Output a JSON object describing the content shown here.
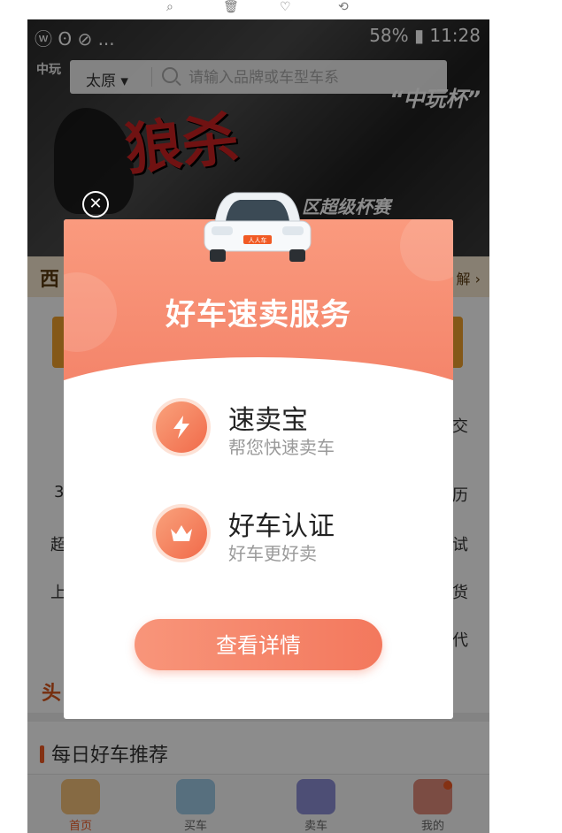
{
  "status_bar": {
    "left_icons_text": "ⓦ ʘ ⊘ ...",
    "right_text": "58% ▮ 11:28"
  },
  "banner": {
    "logo_text": "中玩",
    "title_text": "狼杀",
    "cup_text": "“中玩杯”",
    "league_text": "区超级杯赛"
  },
  "search": {
    "city": "太原 ▾",
    "placeholder": "请输入品牌或车型车系"
  },
  "promo_strip": {
    "left_text": "西",
    "right_text": "解 ›"
  },
  "background_list": {
    "items": [
      "3",
      "超",
      "上",
      "头"
    ],
    "right_items": [
      "交",
      "历",
      "试",
      "货",
      "代"
    ]
  },
  "section": {
    "daily_title": "每日好车推荐"
  },
  "tabbar": {
    "tabs": [
      {
        "label": "首页"
      },
      {
        "label": "买车"
      },
      {
        "label": "卖车"
      },
      {
        "label": "我的"
      }
    ]
  },
  "modal": {
    "close_glyph": "✕",
    "title": "好车速卖服务",
    "features": [
      {
        "title": "速卖宝",
        "subtitle": "帮您快速卖车",
        "icon": "lightning-icon"
      },
      {
        "title": "好车认证",
        "subtitle": "好车更好卖",
        "icon": "crown-icon"
      }
    ],
    "cta_label": "查看详情",
    "car_plate": "人人车"
  },
  "colors": {
    "accent": "#f3785d",
    "brand_orange": "#f15a24",
    "modal_header": "#f4846a"
  }
}
